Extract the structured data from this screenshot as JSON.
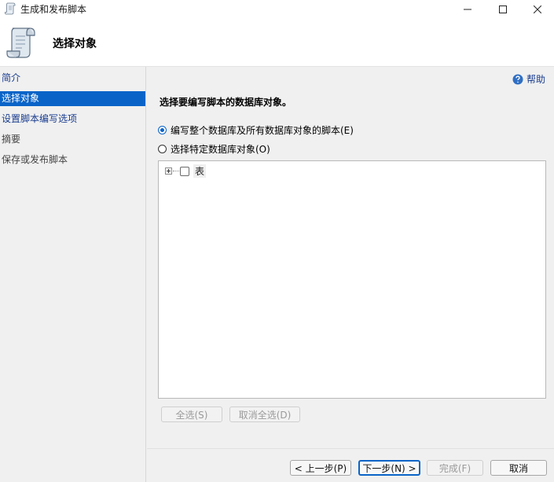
{
  "window": {
    "title": "生成和发布脚本",
    "minimize_icon": "minimize-icon",
    "maximize_icon": "maximize-icon",
    "close_icon": "close-icon"
  },
  "header": {
    "title": "选择对象",
    "icon": "script-scroll-icon"
  },
  "sidebar": {
    "items": [
      {
        "label": "简介",
        "state": "link"
      },
      {
        "label": "选择对象",
        "state": "selected"
      },
      {
        "label": "设置脚本编写选项",
        "state": "link"
      },
      {
        "label": "摘要",
        "state": "disabled"
      },
      {
        "label": "保存或发布脚本",
        "state": "disabled"
      }
    ]
  },
  "help": {
    "label": "帮助",
    "icon": "help-icon"
  },
  "main": {
    "prompt": "选择要编写脚本的数据库对象。",
    "options": [
      {
        "label": "编写整个数据库及所有数据库对象的脚本(E)",
        "selected": true
      },
      {
        "label": "选择特定数据库对象(O)",
        "selected": false
      }
    ],
    "tree": {
      "items": [
        {
          "label": "表",
          "checked": false,
          "expanded": false
        }
      ]
    },
    "select_all_label": "全选(S)",
    "deselect_all_label": "取消全选(D)"
  },
  "footer": {
    "prev_label": "< 上一步(P)",
    "next_label": "下一步(N) >",
    "finish_label": "完成(F)",
    "cancel_label": "取消"
  },
  "colors": {
    "accent": "#0a64c8",
    "link": "#1a3d8f",
    "background": "#f0f0f0"
  }
}
